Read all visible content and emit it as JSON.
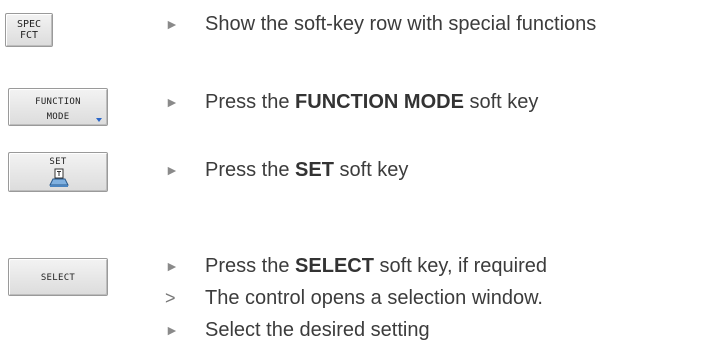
{
  "keys": {
    "spec_fct": {
      "line1": "SPEC",
      "line2": "FCT"
    },
    "function_mode": {
      "line1": "FUNCTION",
      "line2": "MODE"
    },
    "set": {
      "label": "SET"
    },
    "select": {
      "label": "SELECT"
    }
  },
  "markers": {
    "action": "►",
    "result": ">"
  },
  "steps": [
    {
      "text": "Show the soft-key row with special functions"
    },
    {
      "pre": "Press the ",
      "bold": "FUNCTION MODE",
      "post": " soft key"
    },
    {
      "pre": "Press the ",
      "bold": "SET",
      "post": " soft key"
    },
    {
      "pre": "Press the ",
      "bold": "SELECT",
      "post": " soft key, if required"
    },
    {
      "text": "The control opens a selection window."
    },
    {
      "text": "Select the desired setting"
    }
  ],
  "colors": {
    "menu_indicator": "#2a66c8",
    "text": "#3c3c3c",
    "marker": "#8a8a8a"
  }
}
